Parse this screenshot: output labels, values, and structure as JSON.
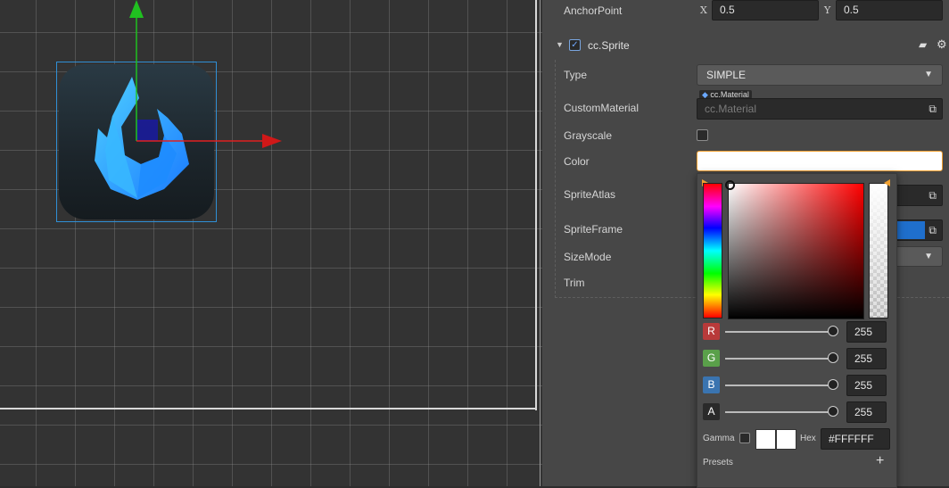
{
  "inspector": {
    "anchor_point": {
      "label": "AnchorPoint",
      "x_axis": "X",
      "x_value": "0.5",
      "y_axis": "Y",
      "y_value": "0.5"
    },
    "component": {
      "title": "cc.Sprite",
      "enabled": true
    },
    "properties": {
      "type": {
        "label": "Type",
        "value": "SIMPLE"
      },
      "custom_material": {
        "label": "CustomMaterial",
        "tag": "cc.Material",
        "placeholder": "cc.Material"
      },
      "grayscale": {
        "label": "Grayscale",
        "checked": false
      },
      "color": {
        "label": "Color",
        "value": "#FFFFFF"
      },
      "sprite_atlas": {
        "label": "SpriteAtlas"
      },
      "sprite_frame": {
        "label": "SpriteFrame"
      },
      "size_mode": {
        "label": "SizeMode"
      },
      "trim": {
        "label": "Trim"
      }
    }
  },
  "color_picker": {
    "channels": [
      {
        "tag": "R",
        "value": "255",
        "color": "#b83a3a"
      },
      {
        "tag": "G",
        "value": "255",
        "color": "#5aa04a"
      },
      {
        "tag": "B",
        "value": "255",
        "color": "#3a74b0"
      },
      {
        "tag": "A",
        "value": "255",
        "color": "#2a2a2a"
      }
    ],
    "gamma_label": "Gamma",
    "hex_label": "Hex",
    "hex_value": "#FFFFFF",
    "presets_label": "Presets",
    "add_symbol": "+"
  },
  "icons": [
    "book-icon",
    "gear-icon",
    "caret-down-icon",
    "picker-icon",
    "plus-icon"
  ],
  "colors": {
    "selection": "#2f8fd6",
    "accent_orange": "#f0a030",
    "x_axis": "#e02020",
    "y_axis": "#20c020"
  }
}
